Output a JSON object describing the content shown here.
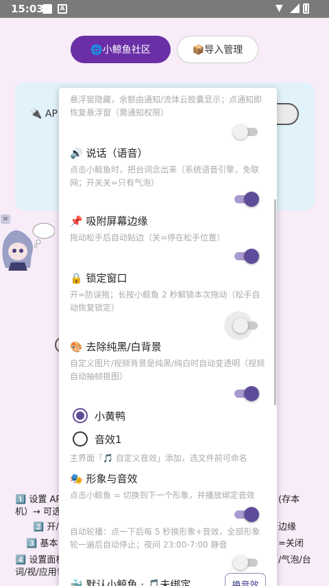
{
  "status_bar": {
    "time": "15:03",
    "notification_icon": "A"
  },
  "top_buttons": {
    "community": "🌐小鲸鱼社区",
    "import": "📦导入管理"
  },
  "background": {
    "api_label": "🔌 AP",
    "line1_left": "1️⃣ 设置 AP",
    "line1_right": "(存本",
    "line2_left": "机）→ 可选",
    "line3_left": "2️⃣ 开/",
    "line3_right": "边缘",
    "line4_left": "3️⃣ 基本",
    "line4_right": "=关闭",
    "line5_left": "4️⃣ 设置面板",
    "line5_right": "/气泡/台",
    "line6_left": "词/视/应用领"
  },
  "sheet": {
    "top_desc": "悬浮窗隐藏，余额由通知/流体云胶囊显示；点通知即恢复悬浮窗（需通知权限）",
    "top_toggle": false,
    "settings": [
      {
        "title": "🔊 说话（语音）",
        "desc": "点击小鲸鱼时，把台词念出来（系统语音引擎，免联网；开关关=只有气泡）",
        "on": true
      },
      {
        "title": "📌 吸附屏幕边缘",
        "desc": "拖动松手后自动贴边（关=停在松手位置）",
        "on": true
      },
      {
        "title": "🔒 锁定窗口",
        "desc": "开=防误拖；长按小鲸鱼 2 秒解锁本次拖动（松手自动恢复锁定）",
        "on": false
      },
      {
        "title": "🎨 去除纯黑/白背景",
        "desc": "自定义图片/视频背景是纯黑/纯白时自动变透明（视频自动抽帧抠图）",
        "on": true
      }
    ],
    "radio_options": [
      "小黄鸭",
      "音效1"
    ],
    "selected_radio": "小黄鸭",
    "sound_hint": "主界面「🎵 自定义音效」添加，选文件前可命名",
    "image_sound": {
      "title": "🎭 形象与音效",
      "desc": "点击小鲸鱼 = 切换到下一个形象，并播放绑定音效",
      "on": true
    },
    "auto_rotate": {
      "desc": "自动轮播：点一下后每 5 秒换形象+音效，全部形象轮一遍后自动停止；夜间 23:00-7:00 静音",
      "on": false
    },
    "default_whale": {
      "title": "🐳 默认小鲸鱼 · 🎵未绑定",
      "button": "换音效"
    }
  }
}
